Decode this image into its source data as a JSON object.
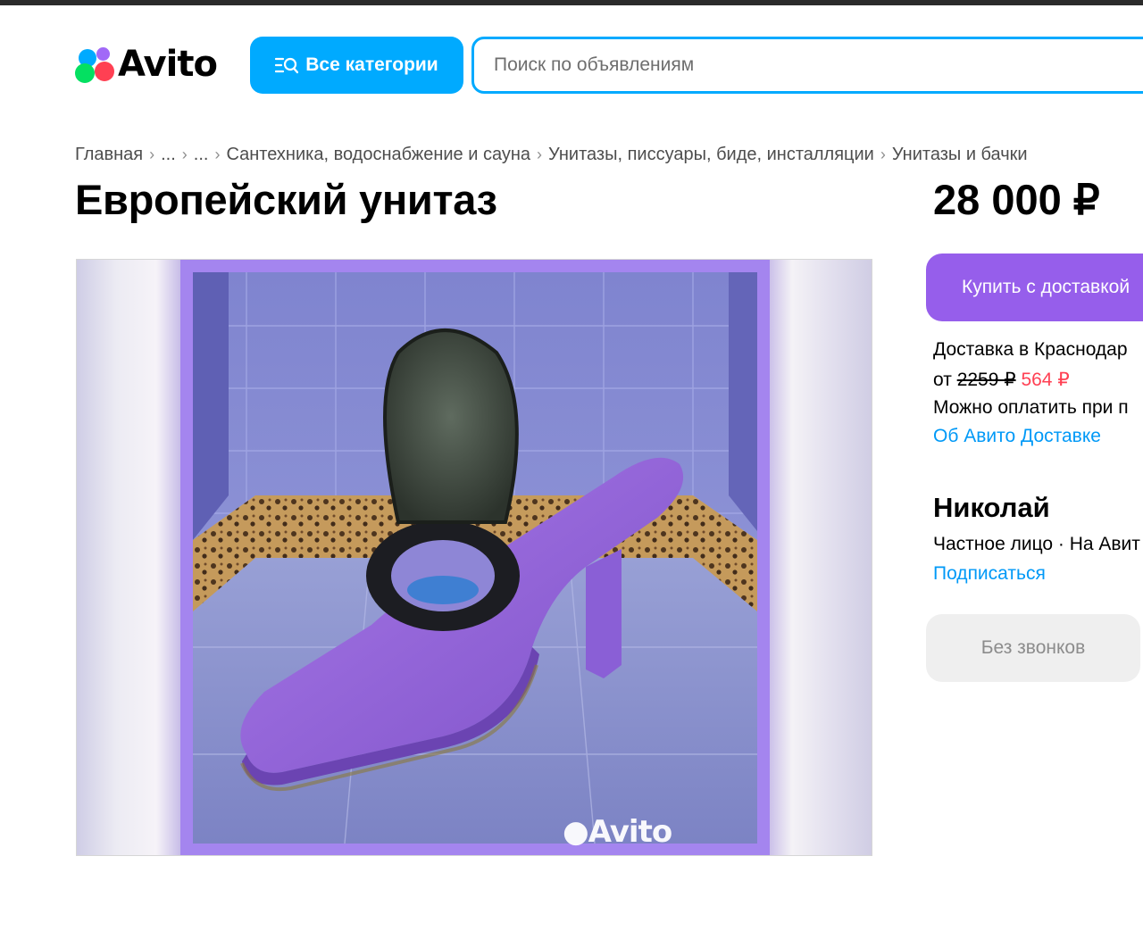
{
  "header": {
    "logo_text": "Avito",
    "categories_button": "Все категории",
    "search_placeholder": "Поиск по объявлениям"
  },
  "breadcrumbs": [
    "Главная",
    "...",
    "...",
    "Сантехника, водоснабжение и сауна",
    "Унитазы, писсуары, биде, инсталляции",
    "Унитазы и бачки"
  ],
  "listing": {
    "title": "Европейский унитаз",
    "price": "28 000 ₽",
    "image_watermark": "Avito"
  },
  "delivery": {
    "buy_button": "Купить с доставкой",
    "city_line": "Доставка в Краснодар",
    "from_label": "от",
    "old_price": "2259 ₽",
    "new_price": "564 ₽",
    "payment_line": "Можно оплатить при п",
    "about_link": "Об Авито Доставке"
  },
  "seller": {
    "name": "Николай",
    "type_line": "Частное лицо · На Авит",
    "subscribe_link": "Подписаться",
    "no_calls_button": "Без звонков"
  },
  "colors": {
    "brand_blue": "#00aaff",
    "buy_purple": "#965eeb",
    "sale_red": "#ff4053",
    "link_blue": "#0099f7"
  }
}
